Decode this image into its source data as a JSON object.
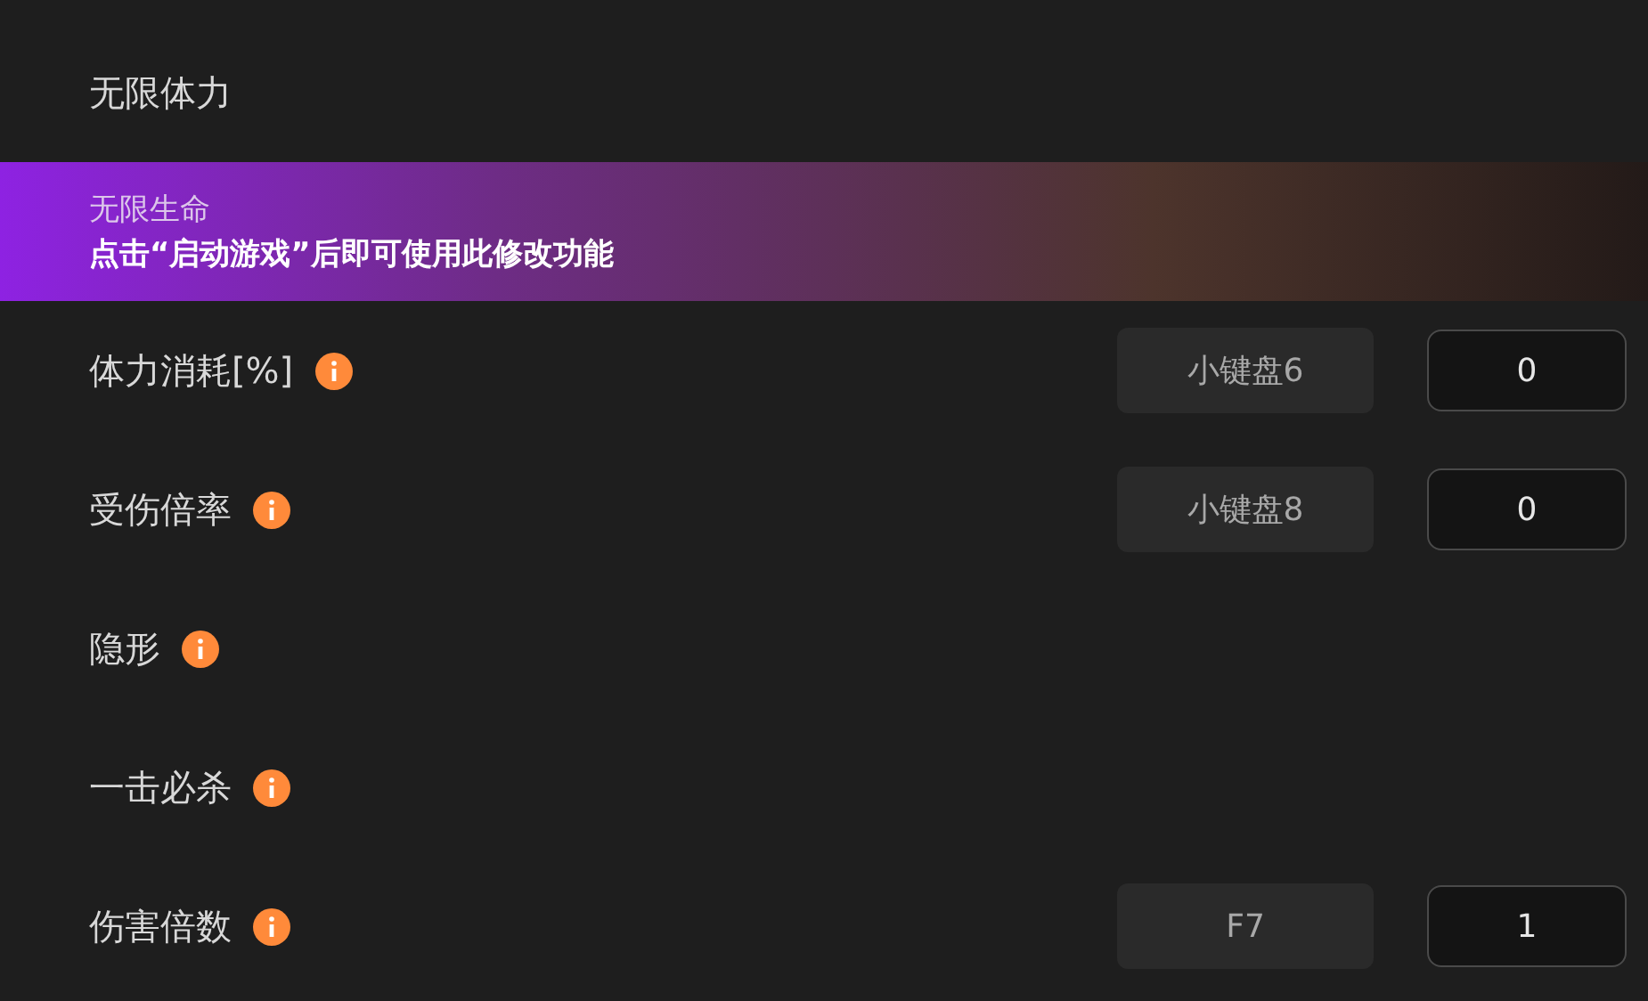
{
  "rows": [
    {
      "label": "无限体力",
      "info": false,
      "selected": false
    },
    {
      "label": "无限生命",
      "info": false,
      "selected": true,
      "hint": "点击“启动游戏”后即可使用此修改功能"
    },
    {
      "label": "体力消耗[%]",
      "info": true,
      "selected": false,
      "hotkey": "小键盘6",
      "value": "0"
    },
    {
      "label": "受伤倍率",
      "info": true,
      "selected": false,
      "hotkey": "小键盘8",
      "value": "0"
    },
    {
      "label": "隐形",
      "info": true,
      "selected": false
    },
    {
      "label": "一击必杀",
      "info": true,
      "selected": false
    },
    {
      "label": "伤害倍数",
      "info": true,
      "selected": false,
      "hotkey": "F7",
      "value": "1"
    }
  ]
}
